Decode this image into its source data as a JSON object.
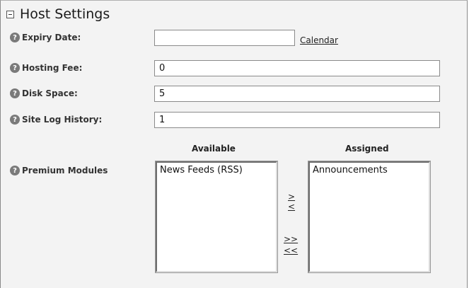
{
  "section": {
    "title": "Host Settings",
    "toggle_icon": "collapse-icon"
  },
  "fields": {
    "expiry": {
      "label": "Expiry Date:",
      "value": "",
      "calendar_link": "Calendar"
    },
    "hosting_fee": {
      "label": "Hosting Fee:",
      "value": "0"
    },
    "disk_space": {
      "label": "Disk Space:",
      "value": "5"
    },
    "site_log": {
      "label": "Site Log History:",
      "value": "1"
    }
  },
  "modules": {
    "label": "Premium Modules",
    "available_header": "Available",
    "assigned_header": "Assigned",
    "available": [
      "News Feeds (RSS)"
    ],
    "assigned": [
      "Announcements"
    ],
    "move_right": ">",
    "move_left": "<",
    "move_all_right": ">>",
    "move_all_left": "<<"
  },
  "help_icon": "help-icon",
  "colors": {
    "background": "#f3f3f3",
    "help_icon": "#7a7a7a"
  }
}
